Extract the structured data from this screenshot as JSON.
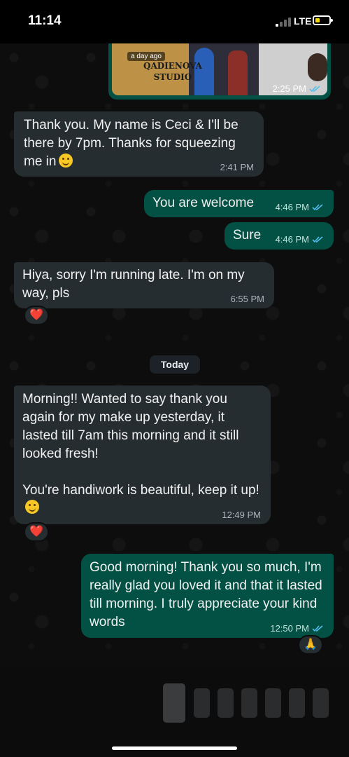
{
  "status_bar": {
    "time": "11:14",
    "network": "LTE"
  },
  "colors": {
    "incoming_bubble": "#262d31",
    "outgoing_bubble": "#025144",
    "read_ticks": "#53bdeb",
    "reaction_heart": "#e32b3b"
  },
  "media_message": {
    "badge": "a day ago",
    "studio_line1": "QADIENOVA",
    "studio_line2": "STUDIO",
    "time": "2:25 PM",
    "status": "read"
  },
  "messages": [
    {
      "direction": "incoming",
      "text": "Thank you. My name is Ceci & I'll be there by 7pm. Thanks for squeezing me in",
      "emoji": "smiling-face",
      "time": "2:41 PM"
    },
    {
      "direction": "outgoing",
      "text": "You are welcome",
      "time": "4:46 PM",
      "status": "read"
    },
    {
      "direction": "outgoing",
      "text": "Sure",
      "time": "4:46 PM",
      "status": "read"
    },
    {
      "direction": "incoming",
      "text": "Hiya, sorry I'm running late. I'm on my way, pls",
      "time": "6:55 PM",
      "reaction": "❤️"
    },
    {
      "direction": "incoming",
      "text": "Morning!! Wanted to say thank you again for my make up yesterday,  it lasted till 7am this morning and it still looked fresh!\n\nYou're handiwork is beautiful,  keep it up!",
      "emoji": "smiling-face",
      "time": "12:49 PM",
      "reaction": "❤️"
    },
    {
      "direction": "outgoing",
      "text": "Good morning! Thank you so much, I'm really glad you loved it and that it lasted till morning. I truly appreciate your kind words",
      "time": "12:50 PM",
      "status": "read",
      "reaction": "🙏"
    }
  ],
  "day_separator": "Today"
}
